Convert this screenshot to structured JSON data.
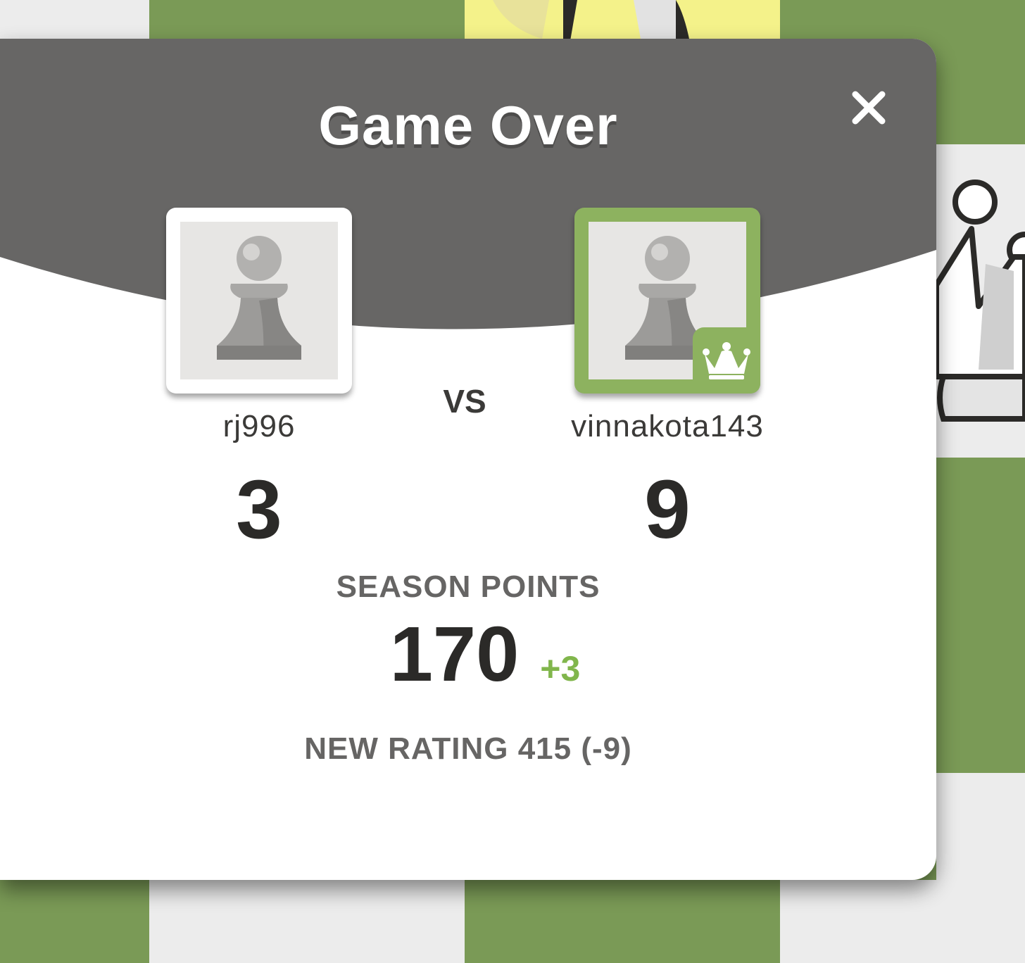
{
  "modal": {
    "title": "Game Over",
    "close_icon": "close-icon"
  },
  "players": {
    "left": {
      "name": "rj996",
      "score": "3",
      "avatar_icon": "pawn-avatar-icon",
      "result": "loser"
    },
    "right": {
      "name": "vinnakota143",
      "score": "9",
      "avatar_icon": "pawn-avatar-icon",
      "badge_icon": "crown-icon",
      "result": "winner"
    }
  },
  "vs_label": "VS",
  "season": {
    "label": "SEASON POINTS",
    "value": "170",
    "delta": "+3"
  },
  "rating": {
    "text": "NEW RATING 415 (-9)"
  },
  "colors": {
    "header": "#676665",
    "winner_accent": "#8db25f",
    "positive_delta": "#81b64c",
    "board_dark": "#7a9a56",
    "board_light": "#ececec"
  }
}
